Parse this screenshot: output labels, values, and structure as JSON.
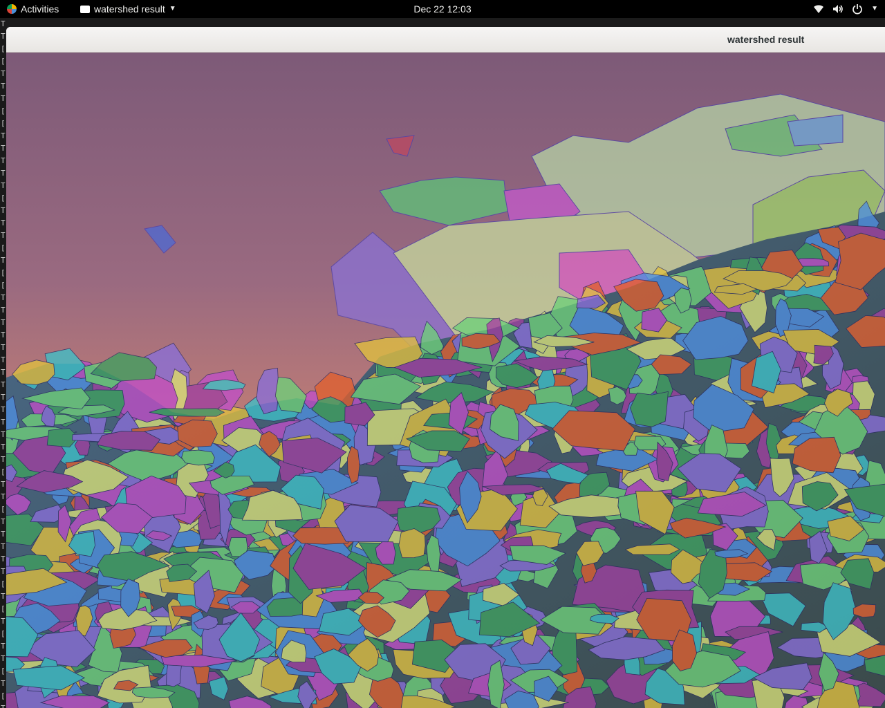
{
  "topbar": {
    "activities_label": "Activities",
    "app_menu_label": "watershed result",
    "clock": "Dec 22  12:03",
    "icons": [
      "wifi-icon",
      "volume-icon",
      "power-icon",
      "chevron-down-icon"
    ]
  },
  "terminal": {
    "line_glyphs": [
      "T",
      "T",
      "[",
      "[",
      "T",
      "T",
      "T",
      "[",
      "[",
      "T",
      "T",
      "T",
      "T",
      "T",
      "[",
      "T",
      "T",
      "T",
      "[",
      "T",
      "[",
      "[",
      "T",
      "T",
      "T",
      "T",
      "T",
      "T",
      "T",
      "T",
      "T",
      "T",
      "T",
      "T",
      "T",
      "T",
      "[",
      "T",
      "T",
      "[",
      "T",
      "T",
      "T",
      "T",
      "T",
      "[",
      "T",
      "[",
      "T",
      "[",
      "T",
      "T",
      "[",
      "T",
      "[",
      "T"
    ]
  },
  "window": {
    "title": "watershed result"
  },
  "image": {
    "description_id": "watershed-segmentation-overlay",
    "palette": [
      "#6fd07a",
      "#c04fc8",
      "#4f8fe0",
      "#8a6fd8",
      "#d8e07a",
      "#3fc0c8",
      "#e0c040",
      "#e06030",
      "#a040a0",
      "#40a060"
    ]
  }
}
